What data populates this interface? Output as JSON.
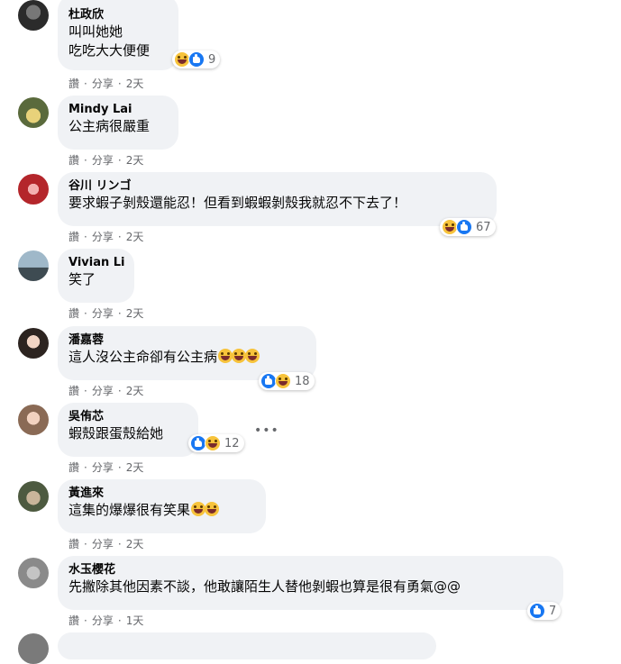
{
  "comments": [
    {
      "author": "杜政欣",
      "lines": [
        "叫叫她她",
        "吃吃大大便便"
      ],
      "reaction_count": "9",
      "actions": {
        "like": "讚",
        "reply": "分享",
        "time": "2天"
      }
    },
    {
      "author": "Mindy Lai",
      "lines": [
        "公主病很嚴重"
      ],
      "actions": {
        "like": "讚",
        "reply": "分享",
        "time": "2天"
      }
    },
    {
      "author": "谷川 リンゴ",
      "lines": [
        "要求蝦子剝殼還能忍！但看到蝦蝦剝殼我就忍不下去了！"
      ],
      "reaction_count": "67",
      "actions": {
        "like": "讚",
        "reply": "分享",
        "time": "2天"
      }
    },
    {
      "author": "Vivian Li",
      "lines": [
        "笑了"
      ],
      "actions": {
        "like": "讚",
        "reply": "分享",
        "time": "2天"
      }
    },
    {
      "author": "潘嘉蓉",
      "lines": [
        "這人沒公主命卻有公主病"
      ],
      "reaction_count": "18",
      "actions": {
        "like": "讚",
        "reply": "分享",
        "time": "2天"
      }
    },
    {
      "author": "吳侑芯",
      "lines": [
        "蝦殼跟蛋殼給她"
      ],
      "reaction_count": "12",
      "more": "•••",
      "actions": {
        "like": "讚",
        "reply": "分享",
        "time": "2天"
      }
    },
    {
      "author": "黃進來",
      "lines": [
        "這集的爆爆很有笑果"
      ],
      "actions": {
        "like": "讚",
        "reply": "分享",
        "time": "2天"
      }
    },
    {
      "author": "水玉櫻花",
      "lines": [
        "先撇除其他因素不談，他敢讓陌生人替他剝蝦也算是很有勇氣@@"
      ],
      "reaction_count": "7",
      "actions": {
        "like": "讚",
        "reply": "分享",
        "time": "1天"
      }
    }
  ],
  "colors": {
    "bubble": "#f0f2f5",
    "meta": "#65676b",
    "like": "#1877f2",
    "haha": "#f7c33b"
  },
  "icons": {
    "like": "like-reaction-icon",
    "haha": "haha-reaction-icon"
  }
}
